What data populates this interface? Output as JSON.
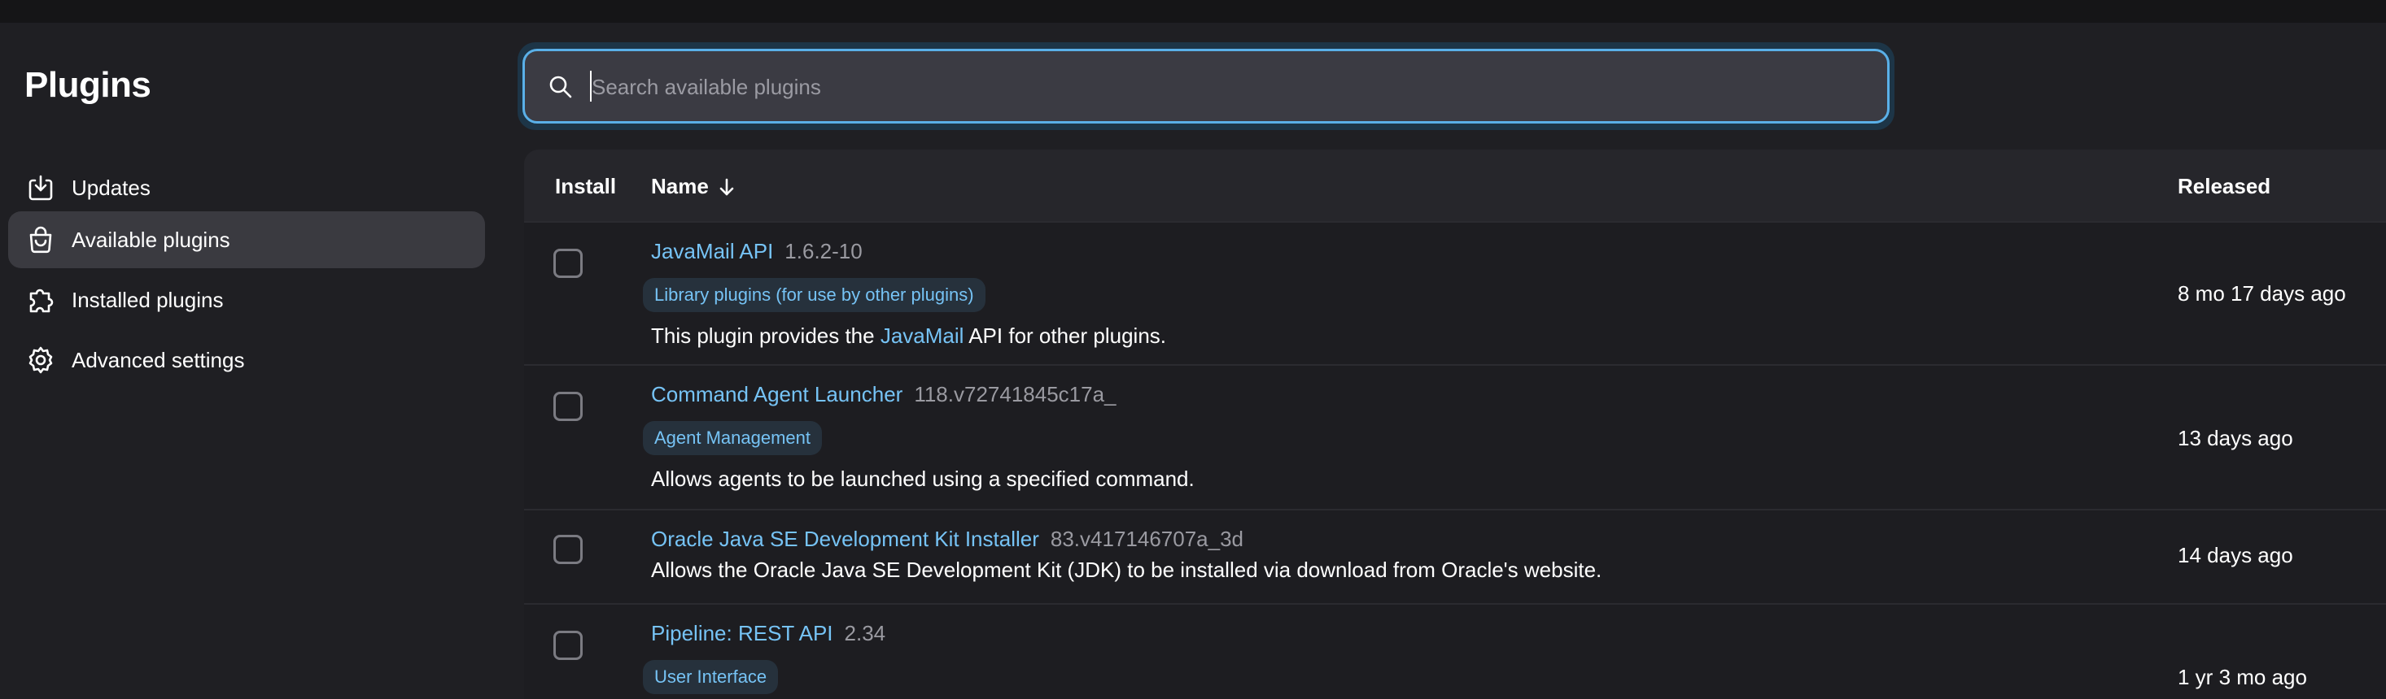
{
  "sidebar": {
    "title": "Plugins",
    "items": [
      {
        "label": "Updates",
        "icon": "download-icon",
        "active": false
      },
      {
        "label": "Available plugins",
        "icon": "shopping-bag-icon",
        "active": true
      },
      {
        "label": "Installed plugins",
        "icon": "puzzle-icon",
        "active": false
      },
      {
        "label": "Advanced settings",
        "icon": "gear-icon",
        "active": false
      }
    ]
  },
  "search": {
    "placeholder": "Search available plugins",
    "value": ""
  },
  "table": {
    "headers": {
      "install": "Install",
      "name": "Name",
      "released": "Released"
    },
    "rows": [
      {
        "name": "JavaMail API",
        "version": "1.6.2-10",
        "tag": "Library plugins (for use by other plugins)",
        "desc_before": "This plugin provides the ",
        "desc_link": "JavaMail",
        "desc_after": " API for other plugins.",
        "released": "8 mo 17 days ago"
      },
      {
        "name": "Command Agent Launcher",
        "version": "118.v72741845c17a_",
        "tag": "Agent Management",
        "description": "Allows agents to be launched using a specified command.",
        "released": "13 days ago"
      },
      {
        "name": "Oracle Java SE Development Kit Installer",
        "version": "83.v417146707a_3d",
        "description": "Allows the Oracle Java SE Development Kit (JDK) to be installed via download from Oracle's website.",
        "released": "14 days ago"
      },
      {
        "name": "Pipeline: REST API",
        "version": "2.34",
        "tag": "User Interface",
        "released": "1 yr 3 mo ago"
      }
    ]
  },
  "colors": {
    "background": "#1f1f23",
    "accent_link": "#76c3f5",
    "focus_border": "#5ab0e8",
    "active_nav": "#3a3a40"
  }
}
